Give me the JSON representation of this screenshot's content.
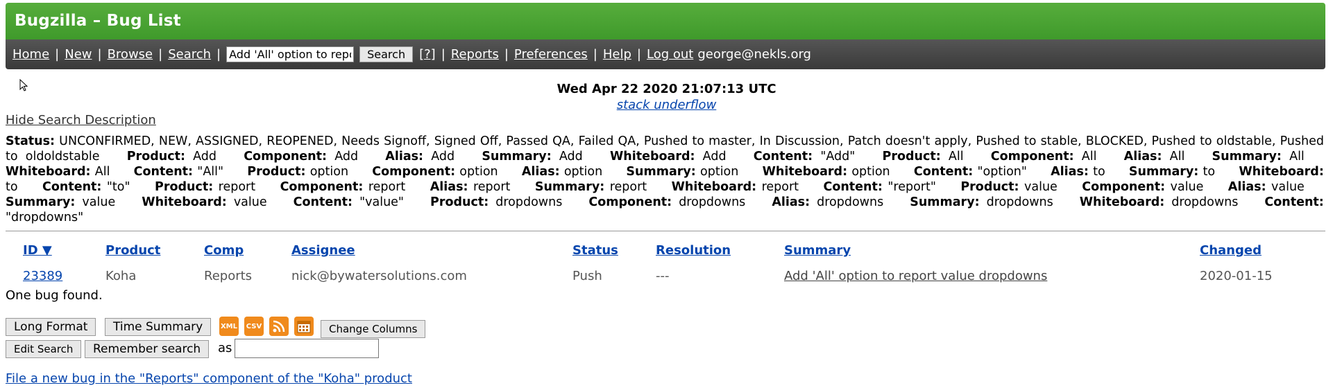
{
  "header": {
    "title": "Bugzilla – Bug List"
  },
  "nav": {
    "items": [
      "Home",
      "New",
      "Browse",
      "Search"
    ],
    "quicksearch_value": "Add 'All' option to repo",
    "search_button": "Search",
    "help_q": "[?]",
    "items2": [
      "Reports",
      "Preferences",
      "Help",
      "Log out"
    ],
    "user": "george@nekls.org"
  },
  "timestamp": "Wed Apr 22 2020 21:07:13 UTC",
  "quip": "stack underflow",
  "hide_description": "Hide Search Description",
  "criteria": [
    {
      "label": "Status:",
      "value": "UNCONFIRMED, NEW, ASSIGNED, REOPENED, Needs Signoff, Signed Off, Passed QA, Failed QA, Pushed to master, In Discussion, Patch doesn't apply, Pushed to stable, BLOCKED, Pushed to oldstable, Pushed to oldoldstable"
    },
    {
      "label": "Product:",
      "value": "Add"
    },
    {
      "label": "Component:",
      "value": "Add"
    },
    {
      "label": "Alias:",
      "value": "Add"
    },
    {
      "label": "Summary:",
      "value": "Add"
    },
    {
      "label": "Whiteboard:",
      "value": "Add"
    },
    {
      "label": "Content:",
      "value": "\"Add\""
    },
    {
      "label": "Product:",
      "value": "All"
    },
    {
      "label": "Component:",
      "value": "All"
    },
    {
      "label": "Alias:",
      "value": "All"
    },
    {
      "label": "Summary:",
      "value": "All"
    },
    {
      "label": "Whiteboard:",
      "value": "All"
    },
    {
      "label": "Content:",
      "value": "\"All\""
    },
    {
      "label": "Product:",
      "value": "option"
    },
    {
      "label": "Component:",
      "value": "option"
    },
    {
      "label": "Alias:",
      "value": "option"
    },
    {
      "label": "Summary:",
      "value": "option"
    },
    {
      "label": "Whiteboard:",
      "value": "option"
    },
    {
      "label": "Content:",
      "value": "\"option\""
    },
    {
      "label": "Alias:",
      "value": "to"
    },
    {
      "label": "Summary:",
      "value": "to"
    },
    {
      "label": "Whiteboard:",
      "value": "to"
    },
    {
      "label": "Content:",
      "value": "\"to\""
    },
    {
      "label": "Product:",
      "value": "report"
    },
    {
      "label": "Component:",
      "value": "report"
    },
    {
      "label": "Alias:",
      "value": "report"
    },
    {
      "label": "Summary:",
      "value": "report"
    },
    {
      "label": "Whiteboard:",
      "value": "report"
    },
    {
      "label": "Content:",
      "value": "\"report\""
    },
    {
      "label": "Product:",
      "value": "value"
    },
    {
      "label": "Component:",
      "value": "value"
    },
    {
      "label": "Alias:",
      "value": "value"
    },
    {
      "label": "Summary:",
      "value": "value"
    },
    {
      "label": "Whiteboard:",
      "value": "value"
    },
    {
      "label": "Content:",
      "value": "\"value\""
    },
    {
      "label": "Product:",
      "value": "dropdowns"
    },
    {
      "label": "Component:",
      "value": "dropdowns"
    },
    {
      "label": "Alias:",
      "value": "dropdowns"
    },
    {
      "label": "Summary:",
      "value": "dropdowns"
    },
    {
      "label": "Whiteboard:",
      "value": "dropdowns"
    },
    {
      "label": "Content:",
      "value": "\"dropdowns\""
    }
  ],
  "table": {
    "headers": {
      "id": "ID ▼",
      "product": "Product",
      "comp": "Comp",
      "assignee": "Assignee",
      "status": "Status",
      "resolution": "Resolution",
      "summary": "Summary",
      "changed": "Changed"
    },
    "rows": [
      {
        "id": "23389",
        "product": "Koha",
        "comp": "Reports",
        "assignee": "nick@bywatersolutions.com",
        "status": "Push",
        "resolution": "---",
        "summary": "Add 'All' option to report value dropdowns",
        "changed": "2020-01-15"
      }
    ]
  },
  "found_text": "One bug found.",
  "buttons": {
    "long_format": "Long Format",
    "time_summary": "Time Summary",
    "change_columns": "Change Columns",
    "edit_search": "Edit Search",
    "remember_search": "Remember search",
    "as": "as"
  },
  "format_icons": [
    {
      "name": "xml-icon",
      "label": "XML",
      "color": "#f08a1c"
    },
    {
      "name": "csv-icon",
      "label": "CSV",
      "color": "#f08a1c"
    },
    {
      "name": "rss-icon",
      "label": "",
      "color": "#f08a1c"
    },
    {
      "name": "ical-icon",
      "label": "",
      "color": "#f08a1c"
    }
  ],
  "file_bug_link": "File a new bug in the \"Reports\" component of the \"Koha\" product",
  "colors": {
    "header_green": "#4aa535",
    "nav_dark": "#444444",
    "link": "#0645ad"
  }
}
